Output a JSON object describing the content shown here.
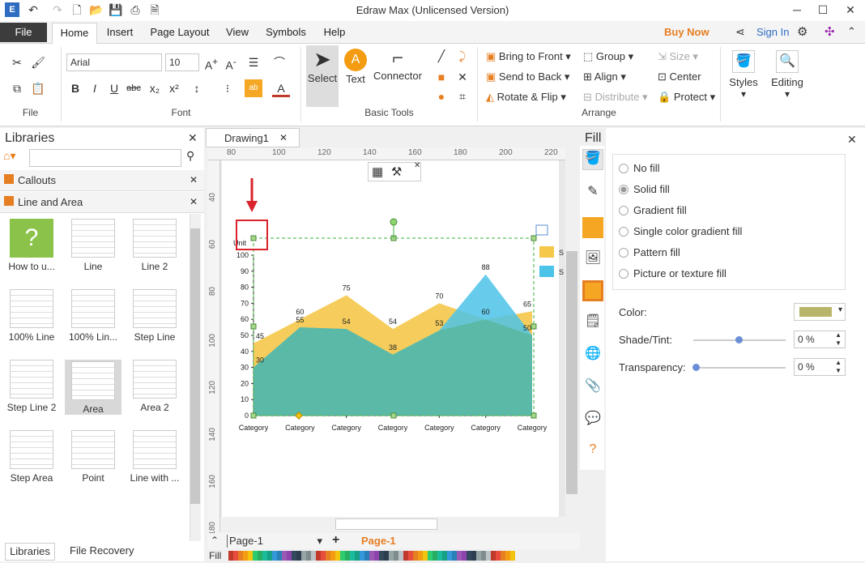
{
  "window": {
    "title": "Edraw Max (Unlicensed Version)"
  },
  "tabs": [
    "File",
    "Home",
    "Insert",
    "Page Layout",
    "View",
    "Symbols",
    "Help"
  ],
  "account": {
    "buy": "Buy Now",
    "signin": "Sign In"
  },
  "font": {
    "name": "Arial",
    "size": "10"
  },
  "groups": {
    "file": "File",
    "font": "Font",
    "basic": "Basic Tools",
    "arrange": "Arrange"
  },
  "basic_tools": {
    "select": "Select",
    "text": "Text",
    "connector": "Connector"
  },
  "arrange": {
    "front": "Bring to Front",
    "back": "Send to Back",
    "rotate": "Rotate & Flip",
    "group": "Group",
    "align": "Align",
    "distribute": "Distribute",
    "size": "Size",
    "center": "Center",
    "protect": "Protect"
  },
  "ribbon_right": {
    "styles": "Styles",
    "editing": "Editing"
  },
  "libraries": {
    "title": "Libraries",
    "sections": [
      "Callouts",
      "Line and Area"
    ],
    "items": [
      "How to u...",
      "Line",
      "Line 2",
      "100% Line",
      "100% Lin...",
      "Step Line",
      "Step Line 2",
      "Area",
      "Area 2",
      "Step Area",
      "Point",
      "Line with ..."
    ],
    "bottom_tabs": [
      "Libraries",
      "File Recovery"
    ]
  },
  "document": {
    "tab": "Drawing1",
    "page_tab": "Page-1",
    "page_current": "Page-1",
    "fill_label": "Fill"
  },
  "ruler": {
    "h": [
      "80",
      "100",
      "120",
      "140",
      "160",
      "180",
      "200",
      "220"
    ],
    "v": [
      "40",
      "60",
      "80",
      "100",
      "120",
      "140",
      "160",
      "180"
    ]
  },
  "fill_panel": {
    "title": "Fill",
    "options": [
      "No fill",
      "Solid fill",
      "Gradient fill",
      "Single color gradient fill",
      "Pattern fill",
      "Picture or texture fill"
    ],
    "selected": "Solid fill",
    "color_label": "Color:",
    "shade_label": "Shade/Tint:",
    "shade_value": "0 %",
    "transparency_label": "Transparency:",
    "transparency_value": "0 %",
    "color_value": "#b8b56a"
  },
  "chart_data": {
    "type": "area",
    "ylabel": "Unit",
    "ylim": [
      0,
      100
    ],
    "yticks": [
      "100",
      "90",
      "80",
      "70",
      "60",
      "50",
      "40",
      "30",
      "20",
      "10",
      "0"
    ],
    "categories": [
      "Category",
      "Category",
      "Category",
      "Category",
      "Category",
      "Category",
      "Category"
    ],
    "series": [
      {
        "values": [
          45,
          60,
          75,
          54,
          70,
          60,
          65
        ],
        "labels": [
          "45",
          "60",
          "75",
          "54",
          "70",
          "60",
          "65"
        ],
        "color": "#f5c84a"
      },
      {
        "values": [
          30,
          55,
          54,
          38,
          53,
          88,
          50
        ],
        "labels": [
          "30",
          "55",
          "54",
          "38",
          "53",
          "88",
          "50"
        ],
        "color": "#4cc3e8"
      }
    ],
    "legend_entries": [
      "S",
      "S"
    ]
  },
  "colors": {
    "accent": "#c0392b",
    "brand": "#2d6cc0",
    "file_tab": "#3c3c3c"
  }
}
